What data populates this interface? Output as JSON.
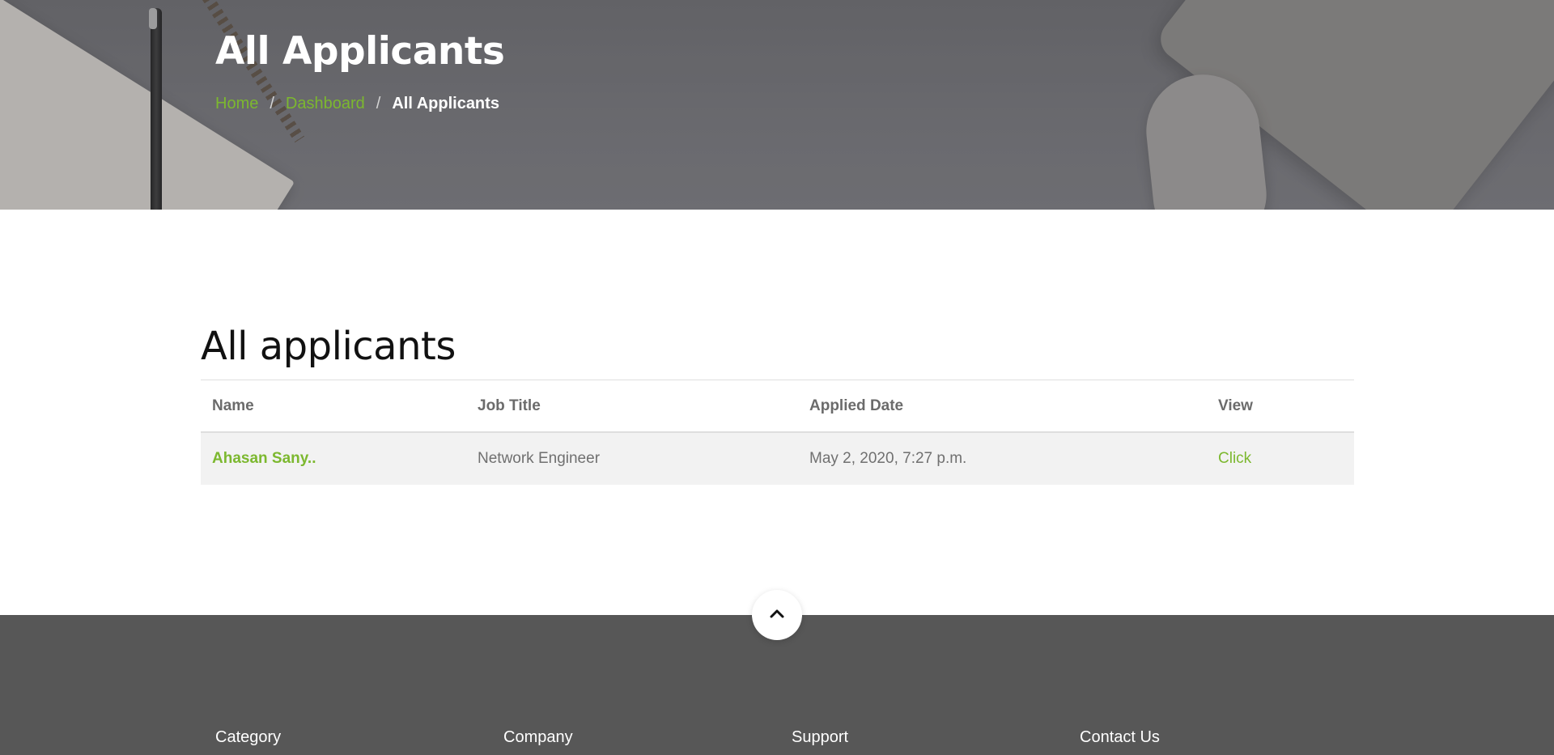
{
  "hero": {
    "title": "All Applicants",
    "breadcrumb": {
      "home": "Home",
      "dashboard": "Dashboard",
      "current": "All Applicants",
      "separator": "/"
    }
  },
  "main": {
    "title": "All applicants",
    "table": {
      "headers": {
        "name": "Name",
        "job_title": "Job Title",
        "applied_date": "Applied Date",
        "view": "View"
      },
      "rows": [
        {
          "name": "Ahasan Sany..",
          "job_title": "Network Engineer",
          "applied_date": "May 2, 2020, 7:27 p.m.",
          "view": "Click"
        }
      ]
    }
  },
  "footer": {
    "columns": [
      "Category",
      "Company",
      "Support",
      "Contact Us"
    ]
  },
  "colors": {
    "accent": "#7cb82f",
    "footer_bg": "#575757"
  },
  "icons": {
    "scroll_top": "chevron-up-icon"
  }
}
